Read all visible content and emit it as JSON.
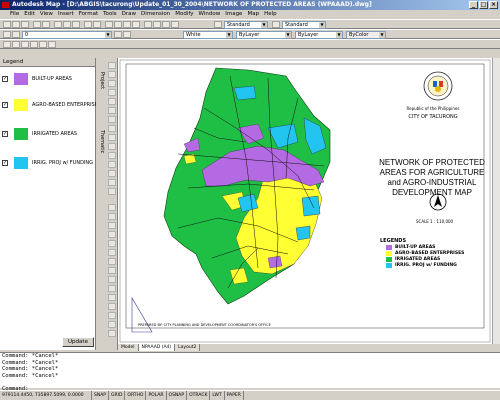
{
  "window": {
    "title": "Autodesk Map - [D:\\ABGIS\\tacurong\\Update_01_30_2004\\NETWORK OF PROTECTED AREAS (WPAAAD).dwg]"
  },
  "menu": [
    "File",
    "Edit",
    "View",
    "Insert",
    "Format",
    "Tools",
    "Draw",
    "Dimension",
    "Modify",
    "Window",
    "Image",
    "Map",
    "Help"
  ],
  "toolbars": {
    "text_style": "Standard",
    "dim_style": "Standard",
    "color": "White",
    "linetype": "ByLayer",
    "lineweight": "ByLayer",
    "plot_style": "ByColor",
    "layer": "0"
  },
  "legend_panel": {
    "title": "Legend",
    "items": [
      {
        "label": "BUILT-UP AREAS",
        "checked": true,
        "color": "#b36ae2"
      },
      {
        "label": "AGRO-BASED ENTERPRISE",
        "checked": true,
        "color": "#ffff33"
      },
      {
        "label": "IRRIGATED AREAS",
        "checked": true,
        "color": "#1fbf45"
      },
      {
        "label": "IRRIG. PROJ w/ FUNDING",
        "checked": true,
        "color": "#22c4f0"
      }
    ],
    "update_label": "Update"
  },
  "side_tabs": [
    "Project",
    "Thematic"
  ],
  "map": {
    "republic": "Republic of the Philippines",
    "city": "CITY OF TACURONG",
    "title": "NETWORK OF PROTECTED AREAS FOR AGRICULTURE and AGRO-INDUSTRIAL DEVELOPMENT MAP",
    "scale": "SCALE    1 : 110,000",
    "legend_title": "LEGENDS",
    "legend": [
      {
        "label": "BUILT-UP AREAS",
        "color": "#b36ae2"
      },
      {
        "label": "AGRO-BASED ENTERPRISES",
        "color": "#ffff33"
      },
      {
        "label": "IRRIGATED AREAS",
        "color": "#1fbf45"
      },
      {
        "label": "IRRIG. PROJ w/ FUNDING",
        "color": "#22c4f0"
      }
    ],
    "footer": "PREPARED BY: CITY PLANNING AND DEVELOPMENT COORDINATOR'S OFFICE"
  },
  "layout_tabs": [
    "Model",
    "NPAAAD (A4)",
    "Layout2"
  ],
  "command_lines": [
    "Command: *Cancel*",
    "Command: *Cancel*",
    "Command: *Cancel*",
    "Command: *Cancel*",
    "",
    "Command:"
  ],
  "status": {
    "coords": "979114.4450, 735897.5099, 0.0000",
    "snap": "SNAP",
    "grid": "GRID",
    "ortho": "ORTHO",
    "polar": "POLAR",
    "osnap": "OSNAP",
    "otrack": "OTRACK",
    "lwt": "LWT",
    "space": "PAPER"
  }
}
